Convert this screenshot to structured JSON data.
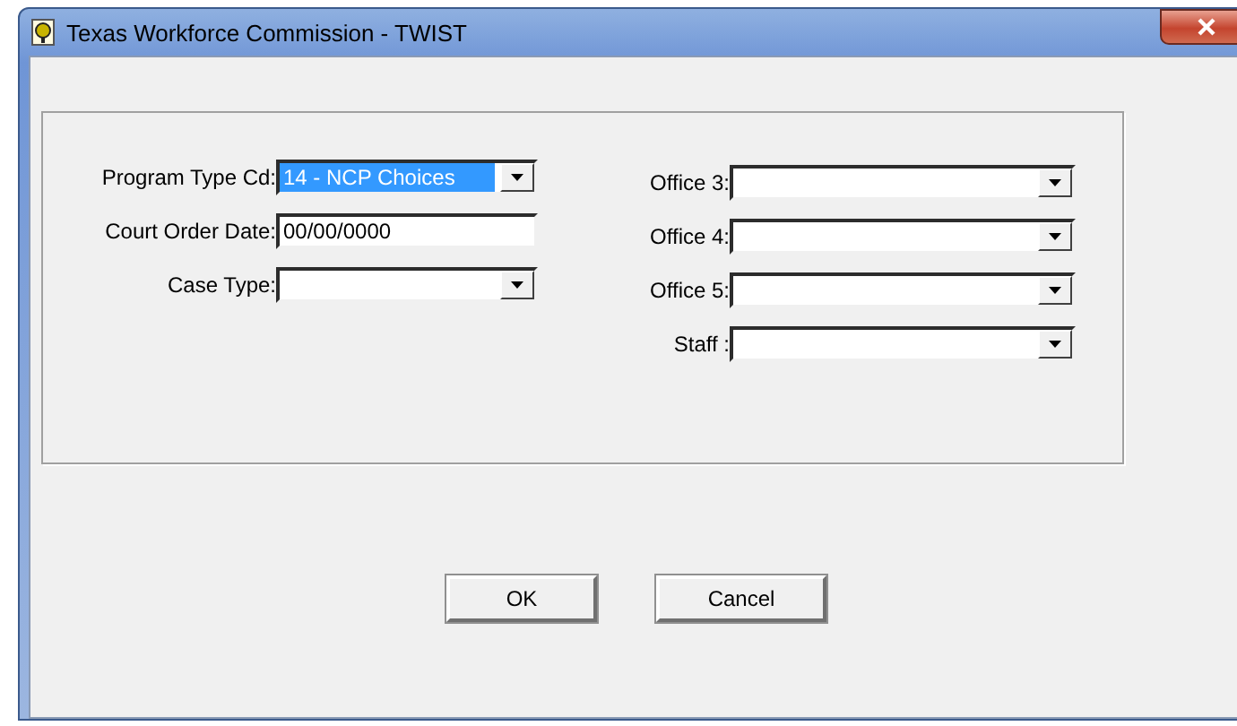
{
  "window": {
    "title": "Texas Workforce Commission - TWIST"
  },
  "left_fields": [
    {
      "label": "Program Type Cd:",
      "kind": "combo",
      "value": "14 - NCP Choices",
      "highlighted": true
    },
    {
      "label": "Court Order Date:",
      "kind": "text",
      "value": "00/00/0000",
      "highlighted": false
    },
    {
      "label": "Case Type:",
      "kind": "combo",
      "highlighted": false
    }
  ],
  "right_fields": [
    {
      "label": "Office 3:",
      "kind": "combo"
    },
    {
      "label": "Office 4:",
      "kind": "combo"
    },
    {
      "label": "Office 5:",
      "kind": "combo"
    },
    {
      "label": "Staff :",
      "kind": "combo"
    }
  ],
  "buttons": [
    "OK",
    "Cancel"
  ]
}
